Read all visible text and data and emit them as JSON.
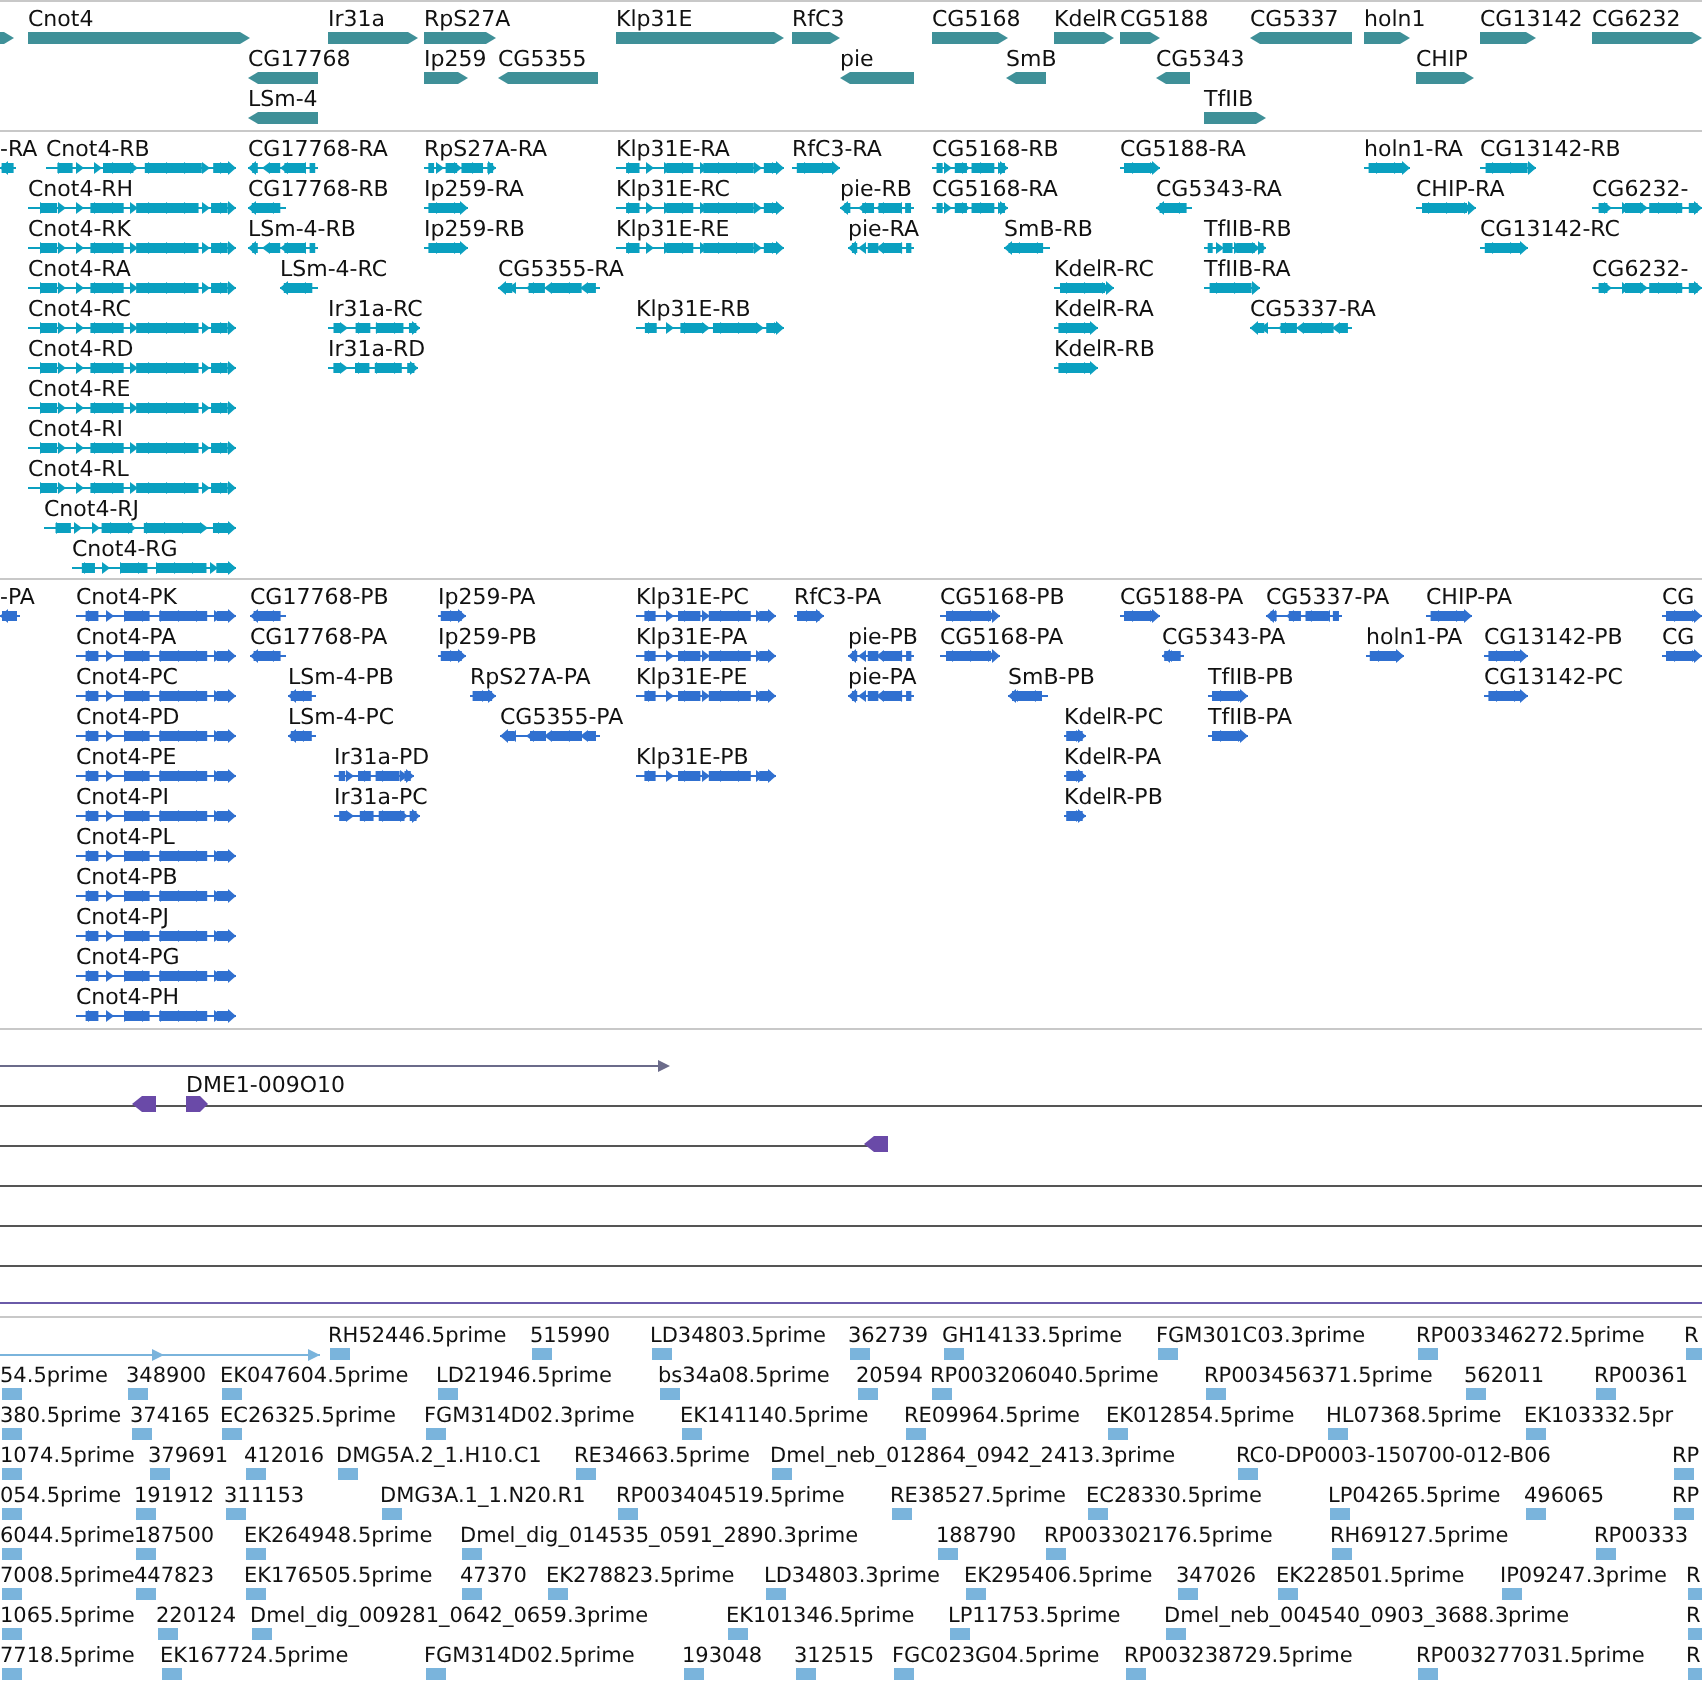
{
  "tracks": [
    {
      "kind": "gene",
      "features": [
        {
          "reverse": false
        },
        {
          "label": "Cnot4",
          "reverse": false
        },
        {
          "label": "CG17768",
          "reverse": true
        },
        {
          "label": "LSm-4",
          "reverse": true
        },
        {
          "label": "Ir31a",
          "reverse": false
        },
        {
          "label": "RpS27A",
          "reverse": false
        },
        {
          "label": "Ip259",
          "reverse": false
        },
        {
          "label": "CG5355",
          "reverse": true
        },
        {
          "label": "Klp31E",
          "reverse": false
        },
        {
          "label": "RfC3",
          "reverse": false
        },
        {
          "label": "pie",
          "reverse": true
        },
        {
          "label": "CG5168",
          "reverse": false
        },
        {
          "label": "SmB",
          "reverse": true
        },
        {
          "label": "KdelR",
          "reverse": false
        },
        {
          "label": "CG5188",
          "reverse": false
        },
        {
          "label": "CG5343",
          "reverse": true
        },
        {
          "label": "TfIIB",
          "reverse": false
        },
        {
          "label": "CG5337",
          "reverse": true
        },
        {
          "label": "holn1",
          "reverse": false
        },
        {
          "label": "CHIP",
          "reverse": false
        },
        {
          "label": "CG13142",
          "reverse": false
        },
        {
          "label": "CG6232",
          "reverse": false
        }
      ]
    },
    {
      "kind": "mrna",
      "features": [
        {
          "label": "-RA",
          "reverse": true
        },
        {
          "label": "Cnot4-RB",
          "reverse": false
        },
        {
          "label": "Cnot4-RH",
          "reverse": false
        },
        {
          "label": "Cnot4-RK",
          "reverse": false
        },
        {
          "label": "Cnot4-RA",
          "reverse": false
        },
        {
          "label": "Cnot4-RC",
          "reverse": false
        },
        {
          "label": "Cnot4-RD",
          "reverse": false
        },
        {
          "label": "Cnot4-RE",
          "reverse": false
        },
        {
          "label": "Cnot4-RI",
          "reverse": false
        },
        {
          "label": "Cnot4-RL",
          "reverse": false
        },
        {
          "label": "Cnot4-RJ",
          "reverse": false
        },
        {
          "label": "Cnot4-RG",
          "reverse": false
        },
        {
          "label": "CG17768-RA",
          "reverse": true
        },
        {
          "label": "CG17768-RB",
          "reverse": true
        },
        {
          "label": "LSm-4-RB",
          "reverse": true
        },
        {
          "label": "LSm-4-RC",
          "reverse": true
        },
        {
          "label": "Ir31a-RC",
          "reverse": false
        },
        {
          "label": "Ir31a-RD",
          "reverse": false
        },
        {
          "label": "RpS27A-RA",
          "reverse": false
        },
        {
          "label": "Ip259-RA",
          "reverse": false
        },
        {
          "label": "Ip259-RB",
          "reverse": false
        },
        {
          "label": "CG5355-RA",
          "reverse": true
        },
        {
          "label": "Klp31E-RA",
          "reverse": false
        },
        {
          "label": "Klp31E-RC",
          "reverse": false
        },
        {
          "label": "Klp31E-RE",
          "reverse": false
        },
        {
          "label": "Klp31E-RB",
          "reverse": false
        },
        {
          "label": "RfC3-RA",
          "reverse": false
        },
        {
          "label": "pie-RB",
          "reverse": true
        },
        {
          "label": "pie-RA",
          "reverse": true
        },
        {
          "label": "CG5168-RB",
          "reverse": false
        },
        {
          "label": "CG5168-RA",
          "reverse": false
        },
        {
          "label": "SmB-RB",
          "reverse": true
        },
        {
          "label": "KdelR-RC",
          "reverse": false
        },
        {
          "label": "KdelR-RA",
          "reverse": false
        },
        {
          "label": "KdelR-RB",
          "reverse": false
        },
        {
          "label": "CG5188-RA",
          "reverse": false
        },
        {
          "label": "CG5343-RA",
          "reverse": true
        },
        {
          "label": "TfIIB-RB",
          "reverse": false
        },
        {
          "label": "TfIIB-RA",
          "reverse": false
        },
        {
          "label": "CG5337-RA",
          "reverse": true
        },
        {
          "label": "holn1-RA",
          "reverse": false
        },
        {
          "label": "CHIP-RA",
          "reverse": false
        },
        {
          "label": "CG13142-RB",
          "reverse": false
        },
        {
          "label": "CG13142-RC",
          "reverse": false
        },
        {
          "label": "CG6232-",
          "reverse": false
        },
        {
          "label": "CG6232-",
          "reverse": false
        }
      ]
    },
    {
      "kind": "protein",
      "features": [
        {
          "label": "-PA",
          "reverse": true
        },
        {
          "label": "Cnot4-PK",
          "reverse": false
        },
        {
          "label": "Cnot4-PA",
          "reverse": false
        },
        {
          "label": "Cnot4-PC",
          "reverse": false
        },
        {
          "label": "Cnot4-PD",
          "reverse": false
        },
        {
          "label": "Cnot4-PE",
          "reverse": false
        },
        {
          "label": "Cnot4-PI",
          "reverse": false
        },
        {
          "label": "Cnot4-PL",
          "reverse": false
        },
        {
          "label": "Cnot4-PB",
          "reverse": false
        },
        {
          "label": "Cnot4-PJ",
          "reverse": false
        },
        {
          "label": "Cnot4-PG",
          "reverse": false
        },
        {
          "label": "Cnot4-PH",
          "reverse": false
        },
        {
          "label": "CG17768-PB",
          "reverse": true
        },
        {
          "label": "CG17768-PA",
          "reverse": true
        },
        {
          "label": "LSm-4-PB",
          "reverse": true
        },
        {
          "label": "LSm-4-PC",
          "reverse": true
        },
        {
          "label": "Ir31a-PD",
          "reverse": false
        },
        {
          "label": "Ir31a-PC",
          "reverse": false
        },
        {
          "label": "Ip259-PA",
          "reverse": false
        },
        {
          "label": "Ip259-PB",
          "reverse": false
        },
        {
          "label": "RpS27A-PA",
          "reverse": false
        },
        {
          "label": "CG5355-PA",
          "reverse": true
        },
        {
          "label": "Klp31E-PC",
          "reverse": false
        },
        {
          "label": "Klp31E-PA",
          "reverse": false
        },
        {
          "label": "Klp31E-PE",
          "reverse": false
        },
        {
          "label": "Klp31E-PB",
          "reverse": false
        },
        {
          "label": "RfC3-PA",
          "reverse": false
        },
        {
          "label": "pie-PB",
          "reverse": true
        },
        {
          "label": "pie-PA",
          "reverse": true
        },
        {
          "label": "CG5168-PB",
          "reverse": false
        },
        {
          "label": "CG5168-PA",
          "reverse": false
        },
        {
          "label": "SmB-PB",
          "reverse": true
        },
        {
          "label": "KdelR-PC",
          "reverse": false
        },
        {
          "label": "KdelR-PA",
          "reverse": false
        },
        {
          "label": "KdelR-PB",
          "reverse": false
        },
        {
          "label": "CG5188-PA",
          "reverse": false
        },
        {
          "label": "CG5343-PA",
          "reverse": true
        },
        {
          "label": "TfIIB-PB",
          "reverse": false
        },
        {
          "label": "TfIIB-PA",
          "reverse": false
        },
        {
          "label": "CG5337-PA",
          "reverse": true
        },
        {
          "label": "CHIP-PA",
          "reverse": false
        },
        {
          "label": "holn1-PA",
          "reverse": false
        },
        {
          "label": "CG13142-PB",
          "reverse": false
        },
        {
          "label": "CG13142-PC",
          "reverse": false
        },
        {
          "label": "CG",
          "reverse": false
        },
        {
          "label": "CG",
          "reverse": false
        }
      ]
    },
    {
      "kind": "match",
      "features": [
        {
          "label": "DME1-009O10",
          "reverse": false
        }
      ]
    },
    {
      "kind": "est",
      "labels": [
        "RH52446.5prime",
        "515990",
        "LD34803.5prime",
        "362739",
        "GH14133.5prime",
        "FGM301C03.3prime",
        "RP003346272.5prime",
        "R",
        "54.5prime",
        "348900",
        "EK047604.5prime",
        "LD21946.5prime",
        "bs34a08.5prime",
        "20594",
        "RP003206040.5prime",
        "RP003456371.5prime",
        "562011",
        "RP00361",
        "380.5prime",
        "374165",
        "EC26325.5prime",
        "FGM314D02.3prime",
        "EK141140.5prime",
        "RE09964.5prime",
        "EK012854.5prime",
        "HL07368.5prime",
        "EK103332.5pr",
        "1074.5prime",
        "379691",
        "412016",
        "DMG5A.2_1.H10.C1",
        "RE34663.5prime",
        "Dmel_neb_012864_0942_2413.3prime",
        "RC0-DP0003-150700-012-B06",
        "RP",
        "054.5prime",
        "191912",
        "311153",
        "DMG3A.1_1.N20.R1",
        "RP003404519.5prime",
        "RE38527.5prime",
        "EC28330.5prime",
        "LP04265.5prime",
        "496065",
        "RP",
        "6044.5prime",
        "187500",
        "EK264948.5prime",
        "Dmel_dig_014535_0591_2890.3prime",
        "188790",
        "RP003302176.5prime",
        "RH69127.5prime",
        "RP00333",
        "7008.5prime",
        "447823",
        "EK176505.5prime",
        "47370",
        "EK278823.5prime",
        "LD34803.3prime",
        "EK295406.5prime",
        "347026",
        "EK228501.5prime",
        "IP09247.3prime",
        "R",
        "1065.5prime",
        "220124",
        "Dmel_dig_009281_0642_0659.3prime",
        "EK101346.5prime",
        "LP11753.5prime",
        "Dmel_neb_004540_0903_3688.3prime",
        "R",
        "7718.5prime",
        "EK167724.5prime",
        "FGM314D02.5prime",
        "193048",
        "312515",
        "FGC023G04.5prime",
        "RP003238729.5prime",
        "RP003277031.5prime",
        "R"
      ]
    }
  ]
}
